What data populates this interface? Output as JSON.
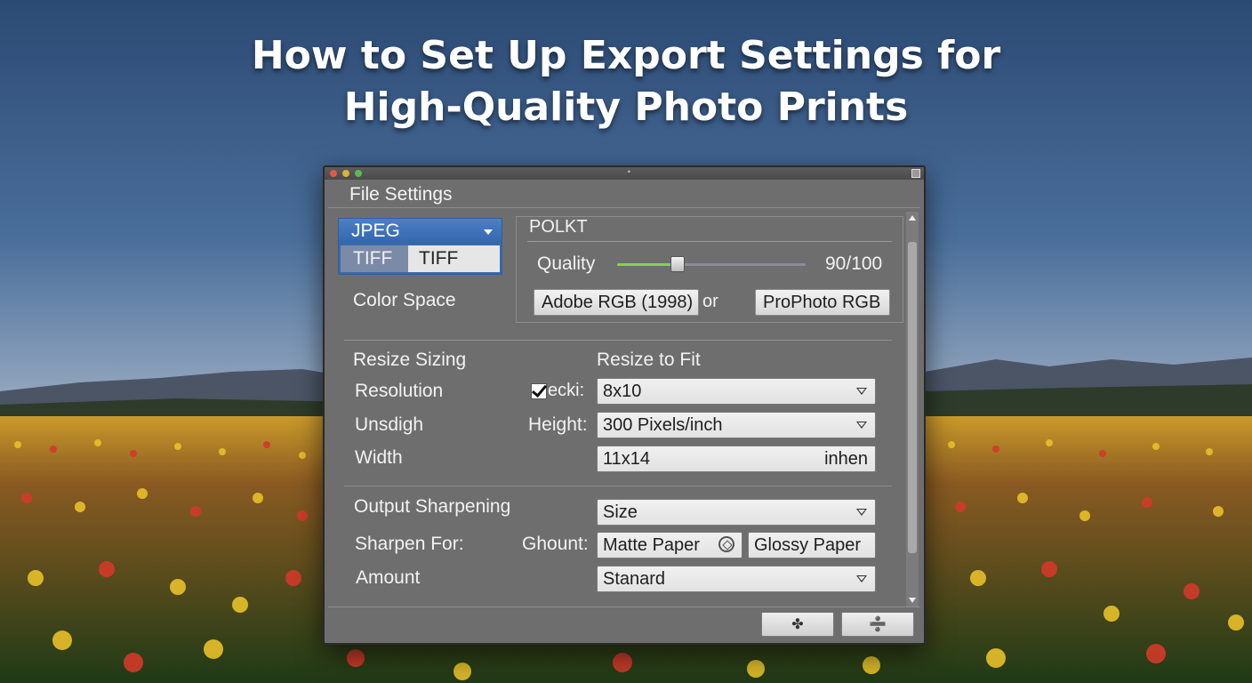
{
  "headline": {
    "line1": "How to Set Up Export Settings for",
    "line2": "High-Quality Photo Prints"
  },
  "window": {
    "title_mark": "•",
    "header": "File Settings",
    "format": {
      "selected": "JPEG",
      "options": [
        "TIFF",
        "TIFF"
      ]
    },
    "color_space_label": "Color Space",
    "quality_group": {
      "title": "POLKT",
      "quality_label": "Quality",
      "quality_value": "90/100",
      "slider_fraction": 0.32,
      "color_space_option_1": "Adobe RGB (1998)",
      "connector": "or",
      "color_space_option_2": "ProPhoto RGB"
    },
    "resize": {
      "label": "Resize Sizing",
      "fit_label": "Resize to Fit",
      "resolution_label": "Resolution",
      "check_label": "ecki:",
      "size_value": "8x10",
      "unsdigh_label": "Unsdigh",
      "height_label": "Height:",
      "resolution_value": "300 Pixels/inch",
      "width_label": "Width",
      "width_value": "11x14",
      "width_unit": "inhen"
    },
    "sharpening": {
      "label": "Output Sharpening",
      "size_value": "Size",
      "sharpen_for_label": "Sharpen For:",
      "ghount_label": "Ghount:",
      "matte": "Matte Paper",
      "glossy": "Glossy Paper",
      "amount_label": "Amount",
      "amount_value": "Stanard"
    },
    "footer": {
      "btn1_glyph": "✤",
      "btn2_glyph": "➗"
    }
  },
  "colors": {
    "sky_top": "#2f4f78",
    "sky_horizon": "#d9a58a",
    "panel": "#6e6e6e",
    "accent_blue": "#3a6bb0",
    "slider_green": "#8ad04a"
  }
}
